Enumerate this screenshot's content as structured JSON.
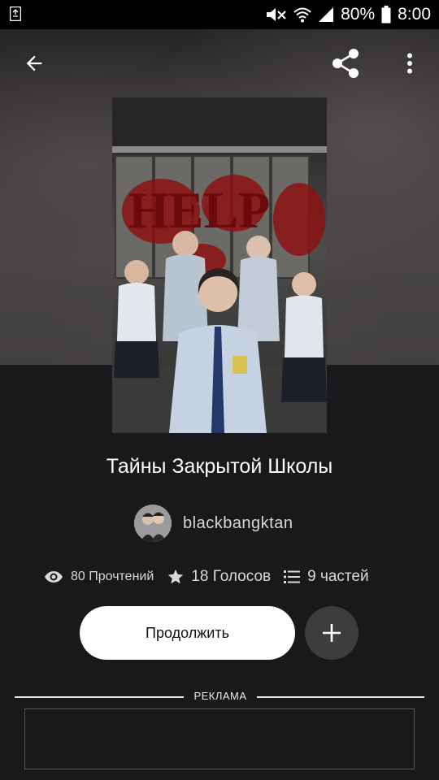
{
  "status_bar": {
    "notification_icon": "recycle-icon",
    "battery_percent": "80%",
    "time": "8:00",
    "icons": [
      "mute-icon",
      "wifi-icon",
      "signal-icon",
      "battery-icon"
    ]
  },
  "toolbar": {
    "back_icon": "arrow-left-icon",
    "share_icon": "share-icon",
    "more_icon": "more-vertical-icon"
  },
  "story": {
    "title": "Тайны Закрытой Школы",
    "author": "blackbangktan",
    "cover_text": "HELP"
  },
  "stats": {
    "reads": "80 Прочтений",
    "votes": "18 Голосов",
    "parts": "9 частей"
  },
  "actions": {
    "continue_label": "Продолжить",
    "add_icon": "plus-icon"
  },
  "ad": {
    "label": "РЕКЛАМА"
  },
  "colors": {
    "background": "#1a181b",
    "button_primary": "#ffffff",
    "button_secondary": "#3e3c3f",
    "text_muted": "#d9d9d9"
  }
}
